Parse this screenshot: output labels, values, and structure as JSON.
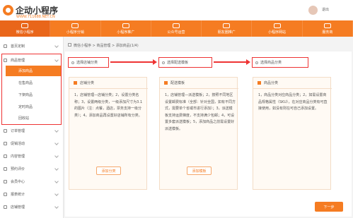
{
  "topbar": {
    "logo_text": "企动小程序",
    "logo_url": "WWW.711688.NET.CN",
    "logout": "退出"
  },
  "nav": [
    {
      "label": "微信小程序",
      "icon": "mini-program-icon"
    },
    {
      "label": "小程序分销",
      "icon": "distribution-icon"
    },
    {
      "label": "小程序推广",
      "icon": "promotion-icon"
    },
    {
      "label": "公众号运营",
      "icon": "official-account-icon"
    },
    {
      "label": "朋友圈推广",
      "icon": "moments-icon"
    },
    {
      "label": "小程序网站",
      "icon": "website-icon"
    },
    {
      "label": "服务商",
      "icon": "service-provider-icon"
    }
  ],
  "sidebar": {
    "items": [
      {
        "label": "首页定制",
        "icon": "home-icon"
      },
      {
        "label": "商品管理",
        "icon": "goods-icon"
      },
      {
        "label": "订单管理",
        "icon": "order-icon"
      },
      {
        "label": "促销活动",
        "icon": "promotion-icon"
      },
      {
        "label": "内容管理",
        "icon": "content-icon"
      },
      {
        "label": "预约评价",
        "icon": "appointment-icon"
      },
      {
        "label": "会员中心",
        "icon": "member-icon"
      },
      {
        "label": "报表统计",
        "icon": "report-icon"
      },
      {
        "label": "店铺管理",
        "icon": "store-icon"
      }
    ],
    "sub_items": [
      "添加商品",
      "在售商品",
      "下架商品",
      "定时商品",
      "回收站"
    ]
  },
  "breadcrumb": "微信小程序 > 商品管理 > 添加商品(1/4)",
  "steps": [
    "选择店铺分类",
    "选择配送模板",
    "选择商品分类"
  ],
  "cards": [
    {
      "title": "店铺分类",
      "body": "1，店铺管理—店铺分类；2，设置分类名称；3，设置两级分类，一级添加尺寸为3.1的图片（注：点餐，酒店，票务支持一级分类）；4，添加商品再设置好店铺所有分类。",
      "button": "添加分类"
    },
    {
      "title": "配送模板",
      "body": "1，店铺管理—派送模板；2，按照不同地区设置邮费标准（全部：针对全国，如有不同方式，需要单个省或市进行添加）；3，派送模板支持运费梯度，不支持满少包邮；4，可设置多套派送模板；5，添加商品之前需设置好派送模板。",
      "button": "添加模板"
    },
    {
      "title": "商品分类",
      "body": "1，商品分类对应商品分类；2，如需设置商品规格属性（SKU），在对应商品分类有可直接使用，如没有则在可自己添加设置。",
      "button": ""
    }
  ],
  "next_button": "下一步",
  "colors": {
    "accent": "#f57c22",
    "highlight": "#e33333"
  }
}
